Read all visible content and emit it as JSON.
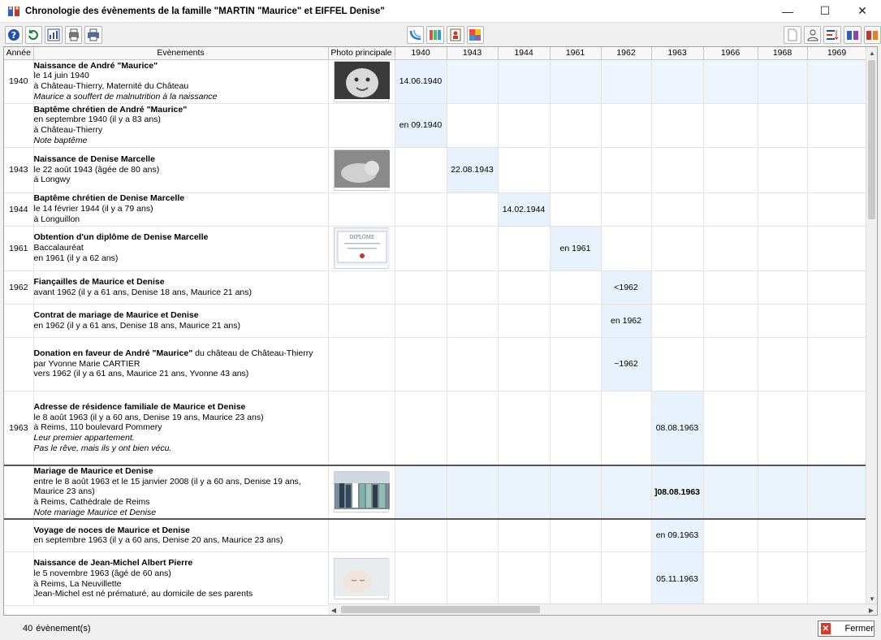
{
  "window": {
    "title": "Chronologie des évènements de la famille \"MARTIN \"Maurice\" et EIFFEL Denise\"",
    "close_label": "Fermer"
  },
  "toolbar": {
    "left": [
      "help-icon",
      "refresh-icon",
      "chart-icon",
      "print-preview-icon",
      "printer-icon"
    ],
    "middle": [
      "timeline-icon",
      "colors-icon",
      "portrait-icon",
      "palette-icon"
    ],
    "right": [
      "document-icon",
      "person-icon",
      "sort-icon",
      "family-icon",
      "gift-icon"
    ]
  },
  "grid": {
    "headers": {
      "year": "Année",
      "event": "Evènements",
      "photo": "Photo principale"
    },
    "years": [
      "1940",
      "1943",
      "1944",
      "1961",
      "1962",
      "1963",
      "1966",
      "1968",
      "1969"
    ],
    "rows": [
      {
        "year": "1940",
        "title": "Naissance de André \"Maurice\"",
        "lines": [
          "le 14 juin 1940",
          "à Château-Thierry, Maternité du Château"
        ],
        "italic": [
          "Maurice a souffert de malnutrition à la naissance"
        ],
        "photo": "baby",
        "col": 0,
        "val": "14.06.1940"
      },
      {
        "year": "",
        "title": "Baptême chrétien de André \"Maurice\"",
        "lines": [
          "en septembre 1940 (il y a 83 ans)",
          "à Château-Thierry"
        ],
        "italic": [
          "Note baptême"
        ],
        "photo": "",
        "col": 0,
        "val": "en 09.1940"
      },
      {
        "year": "1943",
        "title": "Naissance de Denise Marcelle",
        "lines": [
          "le 22 août 1943 (âgée de 80 ans)",
          "à Longwy"
        ],
        "italic": [],
        "photo": "newborn",
        "col": 1,
        "val": "22.08.1943"
      },
      {
        "year": "1944",
        "title": "Baptême chrétien de Denise Marcelle",
        "lines": [
          "le 14 février 1944 (il y a 79 ans)",
          "à Longuillon"
        ],
        "italic": [],
        "photo": "",
        "col": 2,
        "val": "14.02.1944"
      },
      {
        "year": "1961",
        "title": "Obtention d'un diplôme de Denise Marcelle",
        "lines": [
          "Baccalauréat",
          "en 1961 (il y a 62 ans)"
        ],
        "italic": [],
        "photo": "diploma",
        "col": 3,
        "val": "en 1961"
      },
      {
        "year": "1962",
        "title": "Fiançailles de Maurice et Denise",
        "lines": [
          "avant 1962 (il y a 61 ans, Denise 18 ans, Maurice 21 ans)"
        ],
        "italic": [],
        "photo": "",
        "col": 4,
        "val": "<1962"
      },
      {
        "year": "",
        "title": "Contrat de mariage de Maurice et Denise",
        "lines": [
          "en 1962 (il y a 61 ans, Denise 18 ans, Maurice 21 ans)"
        ],
        "italic": [],
        "photo": "",
        "col": 4,
        "val": "en 1962"
      },
      {
        "year": "",
        "title": "Donation en faveur de André \"Maurice\"",
        "title_rest": " du château de Château-Thierry",
        "lines": [
          "par Yvonne Marie CARTIER",
          "vers 1962 (il y a 61 ans, Maurice 21 ans, Yvonne 43 ans)"
        ],
        "italic": [],
        "photo": "",
        "col": 4,
        "val": "~1962"
      },
      {
        "year": "1963",
        "title": "Adresse de résidence familiale de Maurice et Denise",
        "lines": [
          "le 8 août 1963 (il y a 60 ans, Denise 19 ans, Maurice 23 ans)",
          "à Reims, 110 boulevard Pommery"
        ],
        "italic": [
          "Leur premier appartement.",
          "Pas le rêve, mais ils y ont bien vécu."
        ],
        "photo": "",
        "col": 5,
        "val": "08.08.1963"
      },
      {
        "year": "",
        "title": "Mariage de Maurice et Denise",
        "lines": [
          "entre le 8 août 1963 et le 15 janvier 2008 (il y a 60 ans, Denise 19 ans, Maurice 23 ans)",
          "à Reims, Cathédrale de Reims"
        ],
        "italic": [
          "Note mariage Maurice et Denise"
        ],
        "photo": "wedding",
        "col": 5,
        "val": "]08.08.1963",
        "selected": true
      },
      {
        "year": "",
        "title": "Voyage de noces de Maurice et Denise",
        "lines": [
          "en septembre 1963 (il y a 60 ans, Denise 20 ans, Maurice 23 ans)"
        ],
        "italic": [],
        "photo": "",
        "col": 5,
        "val": "en 09.1963"
      },
      {
        "year": "",
        "title": "Naissance de Jean-Michel Albert Pierre",
        "lines": [
          "le 5 novembre 1963 (âgé de 60 ans)",
          "à Reims, La Neuvillette",
          "Jean-Michel est né prématuré, au domicile de ses parents"
        ],
        "italic": [],
        "photo": "sleeping-baby",
        "col": 5,
        "val": "05.11.1963"
      }
    ]
  },
  "status": {
    "count": "40",
    "count_label": "évènement(s)"
  }
}
